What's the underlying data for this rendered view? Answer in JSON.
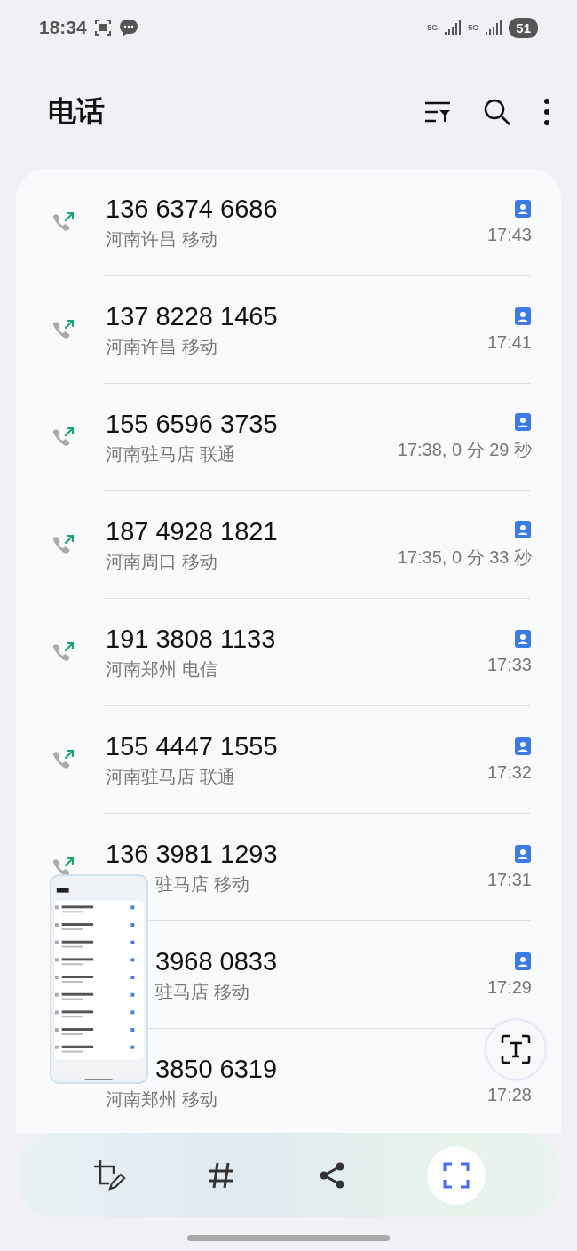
{
  "status_bar": {
    "time": "18:34",
    "network_1": "5G",
    "network_2": "5G",
    "battery": "51"
  },
  "header": {
    "title": "电话"
  },
  "calls": [
    {
      "number": "136 6374 6686",
      "location": "河南许昌 移动",
      "time": "17:43",
      "call_icon": true,
      "contact": true,
      "number_covered": false,
      "location_covered": false
    },
    {
      "number": "137 8228 1465",
      "location": "河南许昌 移动",
      "time": "17:41",
      "call_icon": true,
      "contact": true,
      "number_covered": false,
      "location_covered": false
    },
    {
      "number": "155 6596 3735",
      "location": "河南驻马店 联通",
      "time": "17:38, 0 分 29 秒",
      "call_icon": true,
      "contact": true,
      "number_covered": false,
      "location_covered": false
    },
    {
      "number": "187 4928 1821",
      "location": "河南周口 移动",
      "time": "17:35, 0 分 33 秒",
      "call_icon": true,
      "contact": true,
      "number_covered": false,
      "location_covered": false
    },
    {
      "number": "191 3808 1133",
      "location": "河南郑州 电信",
      "time": "17:33",
      "call_icon": true,
      "contact": true,
      "number_covered": false,
      "location_covered": false
    },
    {
      "number": "155 4447 1555",
      "location": "河南驻马店 联通",
      "time": "17:32",
      "call_icon": true,
      "contact": true,
      "number_covered": false,
      "location_covered": false
    },
    {
      "number": "136 3981 1293",
      "location": "驻马店 移动",
      "time": "17:31",
      "call_icon": true,
      "contact": true,
      "number_covered": false,
      "location_covered": true
    },
    {
      "number": "3968 0833",
      "location": "驻马店 移动",
      "time": "17:29",
      "call_icon": false,
      "contact": true,
      "number_covered": true,
      "location_covered": true
    },
    {
      "number": "3850 6319",
      "location": "河南郑州 移动",
      "time": "17:28",
      "call_icon": false,
      "contact": false,
      "number_covered": true,
      "location_covered": false
    }
  ]
}
